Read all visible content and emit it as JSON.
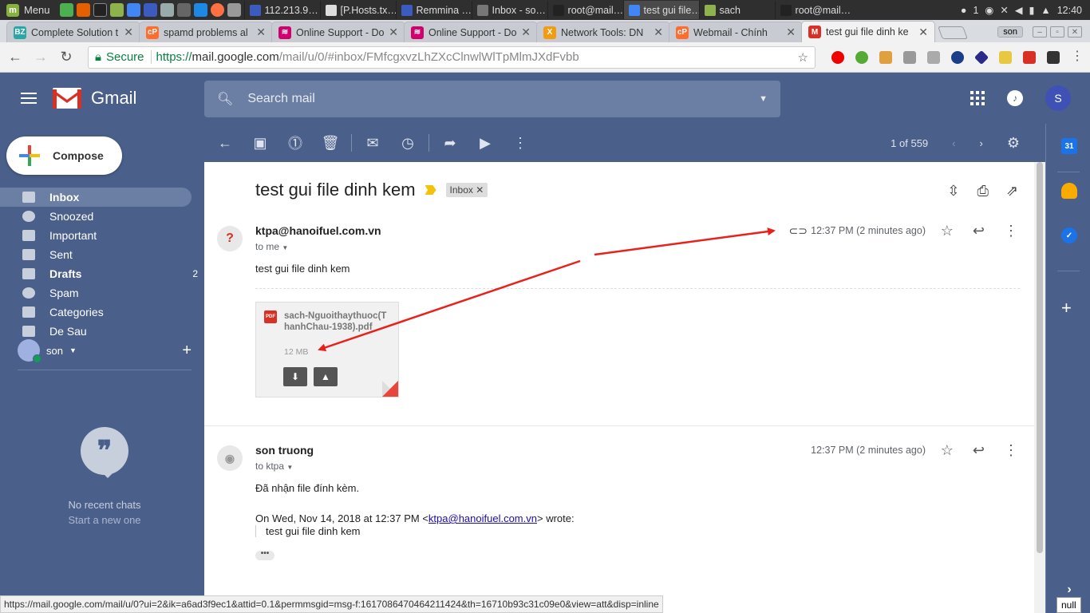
{
  "taskbar": {
    "menu_label": "Menu",
    "windows": [
      {
        "label": "112.213.9…",
        "color": "#3b5bbf"
      },
      {
        "label": "[P.Hosts.tx…",
        "color": "#dddddd"
      },
      {
        "label": "Remmina …",
        "color": "#3b5bbf"
      },
      {
        "label": "Inbox - so…",
        "color": "#777777"
      },
      {
        "label": "root@mail…",
        "color": "#222222"
      },
      {
        "label": "test gui file…",
        "color": "#4285f4",
        "active": true
      },
      {
        "label": "sach",
        "color": "#8fb34c"
      },
      {
        "label": "root@mail…",
        "color": "#222222"
      }
    ],
    "tray_count": "1",
    "clock": "12:40"
  },
  "browser": {
    "tabs": [
      {
        "label": "Complete Solution t",
        "fav": "BZ",
        "fav_color": "#2aa6a6"
      },
      {
        "label": "spamd problems al",
        "fav": "cP",
        "fav_color": "#ff6c2c"
      },
      {
        "label": "Online Support - Do",
        "fav": "≋",
        "fav_color": "#d0006f"
      },
      {
        "label": "Online Support - Do",
        "fav": "≋",
        "fav_color": "#d0006f"
      },
      {
        "label": "Network Tools: DN",
        "fav": "X",
        "fav_color": "#f39c12"
      },
      {
        "label": "Webmail - Chính",
        "fav": "cP",
        "fav_color": "#ff6c2c"
      },
      {
        "label": "test gui file dinh ke",
        "fav": "M",
        "fav_color": "#d93025",
        "active": true
      }
    ],
    "user_badge": "son",
    "secure_label": "Secure",
    "url_scheme": "https://",
    "url_host": "mail.google.com",
    "url_path": "/mail/u/0/#inbox/FMfcgxvzLhZXcClnwlWlTpMlmJXdFvbb"
  },
  "gmail": {
    "logo_text": "Gmail",
    "search_placeholder": "Search mail",
    "avatar_letter": "S",
    "compose_label": "Compose",
    "nav": [
      {
        "label": "Inbox",
        "icon": "inbox-icon",
        "active": true
      },
      {
        "label": "Snoozed",
        "icon": "clock-icon"
      },
      {
        "label": "Important",
        "icon": "important-icon"
      },
      {
        "label": "Sent",
        "icon": "send-icon"
      },
      {
        "label": "Drafts",
        "icon": "draft-icon",
        "count": "2",
        "bold": true
      },
      {
        "label": "Spam",
        "icon": "spam-icon"
      },
      {
        "label": "Categories",
        "icon": "label-icon"
      },
      {
        "label": "De Sau",
        "icon": "label-icon"
      }
    ],
    "hangouts_user": "son",
    "no_chats": "No recent chats",
    "start_chat": "Start a new one",
    "pager": "1 of 559"
  },
  "thread": {
    "subject": "test gui file dinh kem",
    "label": "Inbox",
    "messages": [
      {
        "avatar": "?",
        "sender": "ktpa@hanoifuel.com.vn",
        "to": "to me",
        "time": "12:37 PM (2 minutes ago)",
        "body": "test gui file dinh kem",
        "attachment": {
          "name": "sach-Nguoithaythuoc(ThanhChau-1938).pdf",
          "size": "12 MB",
          "type_label": "PDF"
        }
      },
      {
        "sender": "son truong",
        "to": "to ktpa",
        "time": "12:37 PM (2 minutes ago)",
        "body": "Đã nhận file đính kèm.",
        "quote_prefix": "On Wed, Nov 14, 2018 at 12:37 PM <",
        "quote_email": "ktpa@hanoifuel.com.vn",
        "quote_suffix": "> wrote:",
        "quote_text": "test gui file dinh kem"
      }
    ]
  },
  "status_url": "https://mail.google.com/mail/u/0?ui=2&ik=a6ad3f9ec1&attid=0.1&permmsgid=msg-f:1617086470464211424&th=16710b93c31c09e0&view=att&disp=inline",
  "null_label": "null",
  "colors": {
    "gmail_bg": "#4a5f8a",
    "annotation_red": "#e8211b"
  }
}
